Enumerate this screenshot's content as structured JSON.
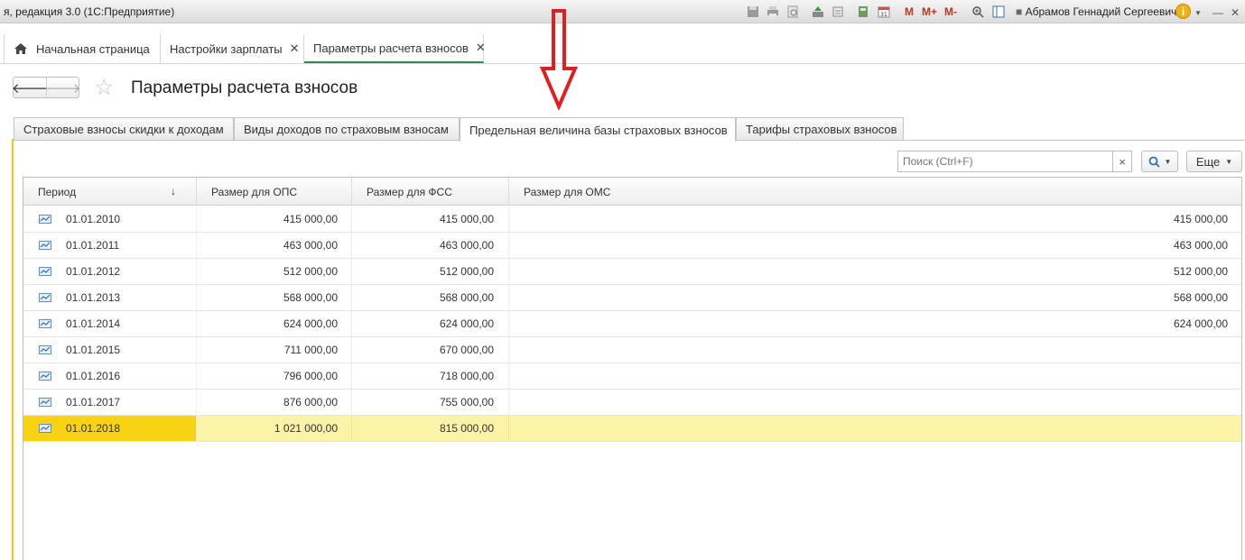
{
  "app": {
    "title": "я, редакция 3.0  (1С:Предприятие)",
    "user": "Абрамов Геннадий Сергеевич",
    "toolbar": {
      "m": "M",
      "m_plus": "M+",
      "m_minus": "M-"
    },
    "minimize": "—",
    "close": "✕"
  },
  "window_tabs": [
    {
      "label": "Начальная страница",
      "icon": "home-icon"
    },
    {
      "label": "Настройки зарплаты",
      "close": "✕"
    },
    {
      "label": "Параметры расчета взносов",
      "close": "✕",
      "active": true
    }
  ],
  "page": {
    "title": "Параметры расчета взносов"
  },
  "content_tabs": [
    {
      "label": "Страховые взносы скидки к доходам"
    },
    {
      "label": "Виды доходов по страховым взносам"
    },
    {
      "label": "Предельная величина базы страховых взносов",
      "active": true
    },
    {
      "label": "Тарифы страховых взносов"
    }
  ],
  "search": {
    "placeholder": "Поиск (Ctrl+F)",
    "clear": "×",
    "more_label": "Еще"
  },
  "table": {
    "headers": [
      "Период",
      "Размер для ОПС",
      "Размер для ФСС",
      "Размер для ОМС"
    ],
    "sort_indicator": "↓",
    "rows": [
      {
        "period": "01.01.2010",
        "ops": "415 000,00",
        "fss": "415 000,00",
        "oms": "415 000,00"
      },
      {
        "period": "01.01.2011",
        "ops": "463 000,00",
        "fss": "463 000,00",
        "oms": "463 000,00"
      },
      {
        "period": "01.01.2012",
        "ops": "512 000,00",
        "fss": "512 000,00",
        "oms": "512 000,00"
      },
      {
        "period": "01.01.2013",
        "ops": "568 000,00",
        "fss": "568 000,00",
        "oms": "568 000,00"
      },
      {
        "period": "01.01.2014",
        "ops": "624 000,00",
        "fss": "624 000,00",
        "oms": "624 000,00"
      },
      {
        "period": "01.01.2015",
        "ops": "711 000,00",
        "fss": "670 000,00",
        "oms": ""
      },
      {
        "period": "01.01.2016",
        "ops": "796 000,00",
        "fss": "718 000,00",
        "oms": ""
      },
      {
        "period": "01.01.2017",
        "ops": "876 000,00",
        "fss": "755 000,00",
        "oms": ""
      },
      {
        "period": "01.01.2018",
        "ops": "1 021 000,00",
        "fss": "815 000,00",
        "oms": "",
        "selected": true
      }
    ]
  },
  "colors": {
    "active_tab_underline": "#2e8b57",
    "selected_row": "#fbf3a7",
    "selected_cell": "#f7d314",
    "annotation_arrow": "#e02020"
  }
}
